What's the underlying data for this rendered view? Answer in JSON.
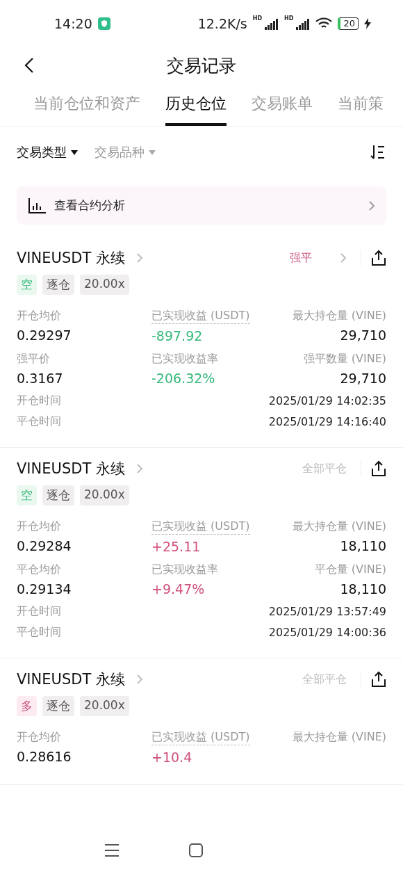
{
  "status_bar": {
    "time": "14:20",
    "speed": "12.2K/s",
    "signal_badges": [
      "HD",
      "HD"
    ],
    "battery": "20"
  },
  "header": {
    "title": "交易记录"
  },
  "tabs": [
    {
      "label": "当前仓位和资产",
      "selected": false
    },
    {
      "label": "历史仓位",
      "selected": true
    },
    {
      "label": "交易账单",
      "selected": false
    },
    {
      "label": "当前策",
      "selected": false
    }
  ],
  "filters": [
    {
      "label": "交易类型",
      "active": true
    },
    {
      "label": "交易品种",
      "active": false
    }
  ],
  "banner": {
    "label": "查看合约分析"
  },
  "positions": [
    {
      "symbol": "VINEUSDT 永续",
      "status": {
        "label": "强平",
        "kind": "liquidation"
      },
      "side": {
        "label": "空",
        "kind": "short"
      },
      "margin_mode": "逐仓",
      "leverage": "20.00x",
      "stats": [
        {
          "label": "开仓均价",
          "value": "0.29297",
          "color": "#111111",
          "dotted": false
        },
        {
          "label": "已实现收益 (USDT)",
          "value": "-897.92",
          "color": "#35b87a",
          "dotted": true
        },
        {
          "label": "最大持仓量 (VINE)",
          "value": "29,710",
          "color": "#111111",
          "dotted": false
        },
        {
          "label": "强平价",
          "value": "0.3167",
          "color": "#111111",
          "dotted": false
        },
        {
          "label": "已实现收益率",
          "value": "-206.32%",
          "color": "#35b87a",
          "dotted": false
        },
        {
          "label": "强平数量 (VINE)",
          "value": "29,710",
          "color": "#111111",
          "dotted": false
        }
      ],
      "times": [
        {
          "label": "开仓时间",
          "value": "2025/01/29 14:02:35"
        },
        {
          "label": "平仓时间",
          "value": "2025/01/29 14:16:40"
        }
      ]
    },
    {
      "symbol": "VINEUSDT 永续",
      "status": {
        "label": "全部平仓",
        "kind": "closed"
      },
      "side": {
        "label": "空",
        "kind": "short"
      },
      "margin_mode": "逐仓",
      "leverage": "20.00x",
      "stats": [
        {
          "label": "开仓均价",
          "value": "0.29284",
          "color": "#111111",
          "dotted": false
        },
        {
          "label": "已实现收益 (USDT)",
          "value": "+25.11",
          "color": "#d24f7c",
          "dotted": true
        },
        {
          "label": "最大持仓量 (VINE)",
          "value": "18,110",
          "color": "#111111",
          "dotted": false
        },
        {
          "label": "平仓均价",
          "value": "0.29134",
          "color": "#111111",
          "dotted": false
        },
        {
          "label": "已实现收益率",
          "value": "+9.47%",
          "color": "#d24f7c",
          "dotted": false
        },
        {
          "label": "平仓量 (VINE)",
          "value": "18,110",
          "color": "#111111",
          "dotted": false
        }
      ],
      "times": [
        {
          "label": "开仓时间",
          "value": "2025/01/29 13:57:49"
        },
        {
          "label": "平仓时间",
          "value": "2025/01/29 14:00:36"
        }
      ]
    },
    {
      "symbol": "VINEUSDT 永续",
      "status": {
        "label": "全部平仓",
        "kind": "closed"
      },
      "side": {
        "label": "多",
        "kind": "long"
      },
      "margin_mode": "逐仓",
      "leverage": "20.00x",
      "stats": [
        {
          "label": "开仓均价",
          "value": "0.28616",
          "color": "#111111",
          "dotted": false
        },
        {
          "label": "已实现收益 (USDT)",
          "value": "+10.4",
          "color": "#d24f7c",
          "dotted": true
        },
        {
          "label": "最大持仓量 (VINE)",
          "dotted": false
        }
      ]
    }
  ]
}
